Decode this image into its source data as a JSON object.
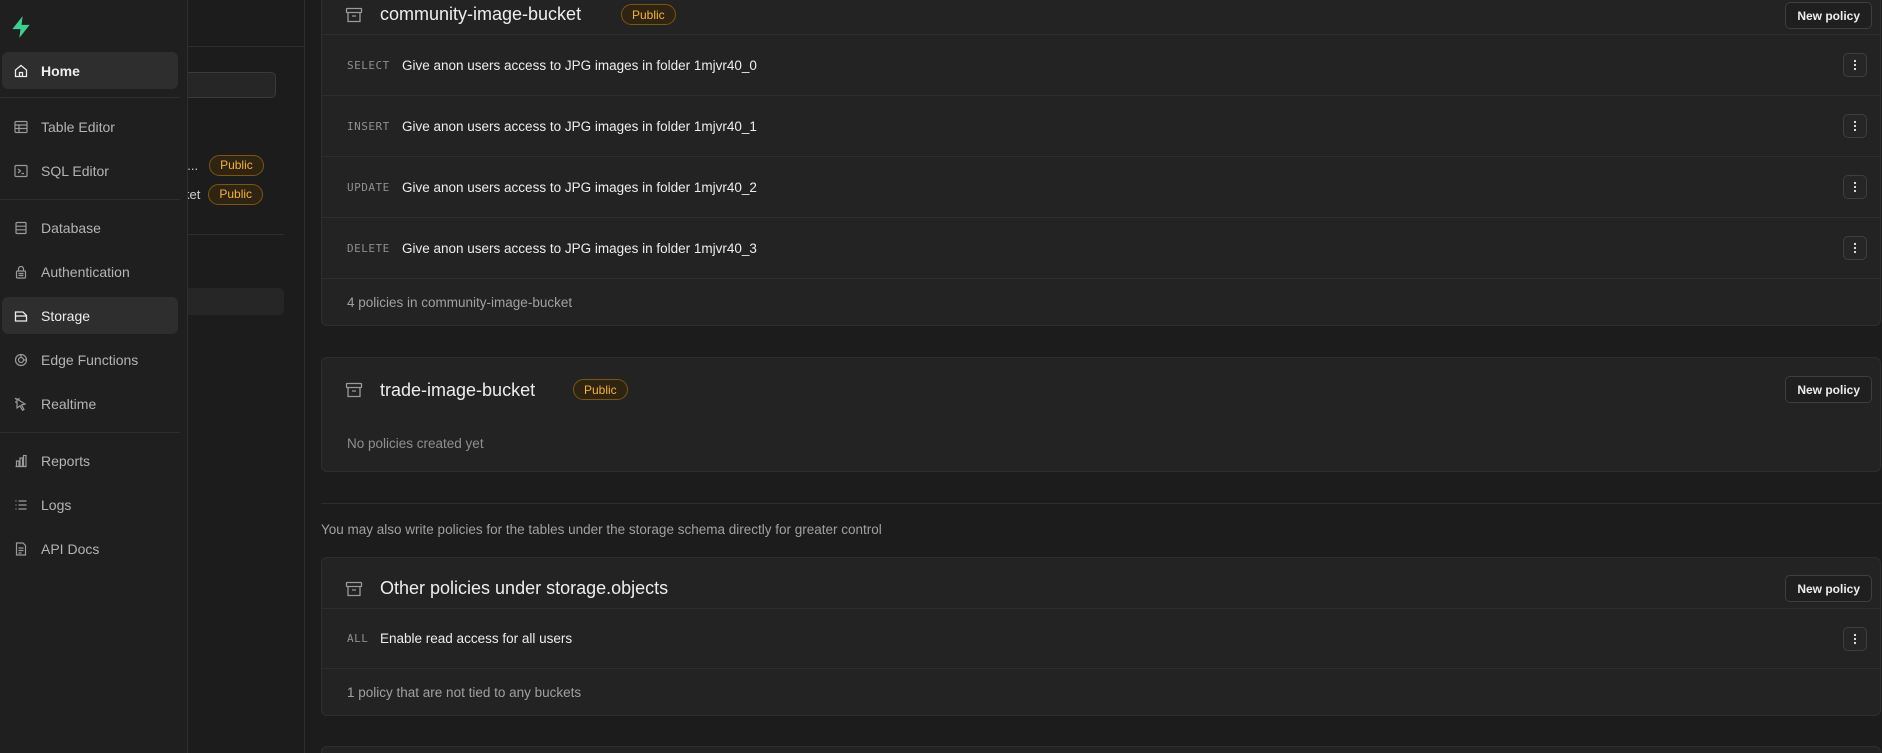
{
  "nav": {
    "items": [
      {
        "label": "Home",
        "icon": "home-icon"
      },
      {
        "label": "Table Editor",
        "icon": "table-icon"
      },
      {
        "label": "SQL Editor",
        "icon": "terminal-icon"
      },
      {
        "label": "Database",
        "icon": "database-icon"
      },
      {
        "label": "Authentication",
        "icon": "lock-icon"
      },
      {
        "label": "Storage",
        "icon": "storage-icon"
      },
      {
        "label": "Edge Functions",
        "icon": "edge-functions-icon"
      },
      {
        "label": "Realtime",
        "icon": "realtime-icon"
      },
      {
        "label": "Reports",
        "icon": "reports-icon"
      },
      {
        "label": "Logs",
        "icon": "logs-icon"
      },
      {
        "label": "API Docs",
        "icon": "api-docs-icon"
      }
    ],
    "active": "Storage"
  },
  "panel": {
    "buckets": [
      {
        "label": "e...",
        "badge": "Public"
      },
      {
        "label": "ket",
        "badge": "Public"
      }
    ]
  },
  "main": {
    "community": {
      "title": "community-image-bucket",
      "badge": "Public",
      "new_policy": "New policy",
      "policies": [
        {
          "command": "SELECT",
          "name": "Give anon users access to JPG images in folder 1mjvr40_0"
        },
        {
          "command": "INSERT",
          "name": "Give anon users access to JPG images in folder 1mjvr40_1"
        },
        {
          "command": "UPDATE",
          "name": "Give anon users access to JPG images in folder 1mjvr40_2"
        },
        {
          "command": "DELETE",
          "name": "Give anon users access to JPG images in folder 1mjvr40_3"
        }
      ],
      "footer": "4 policies in community-image-bucket"
    },
    "trade": {
      "title": "trade-image-bucket",
      "badge": "Public",
      "new_policy": "New policy",
      "empty": "No policies created yet"
    },
    "hint": "You may also write policies for the tables under the storage schema directly for greater control",
    "other": {
      "title": "Other policies under storage.objects",
      "new_policy": "New policy",
      "policies": [
        {
          "command": "ALL",
          "name": "Enable read access for all users"
        }
      ],
      "footer": "1 policy that are not tied to any buckets"
    }
  },
  "colors": {
    "accent": "#3ecf8e",
    "badge_text": "#f3b144",
    "background": "#1c1c1c"
  }
}
